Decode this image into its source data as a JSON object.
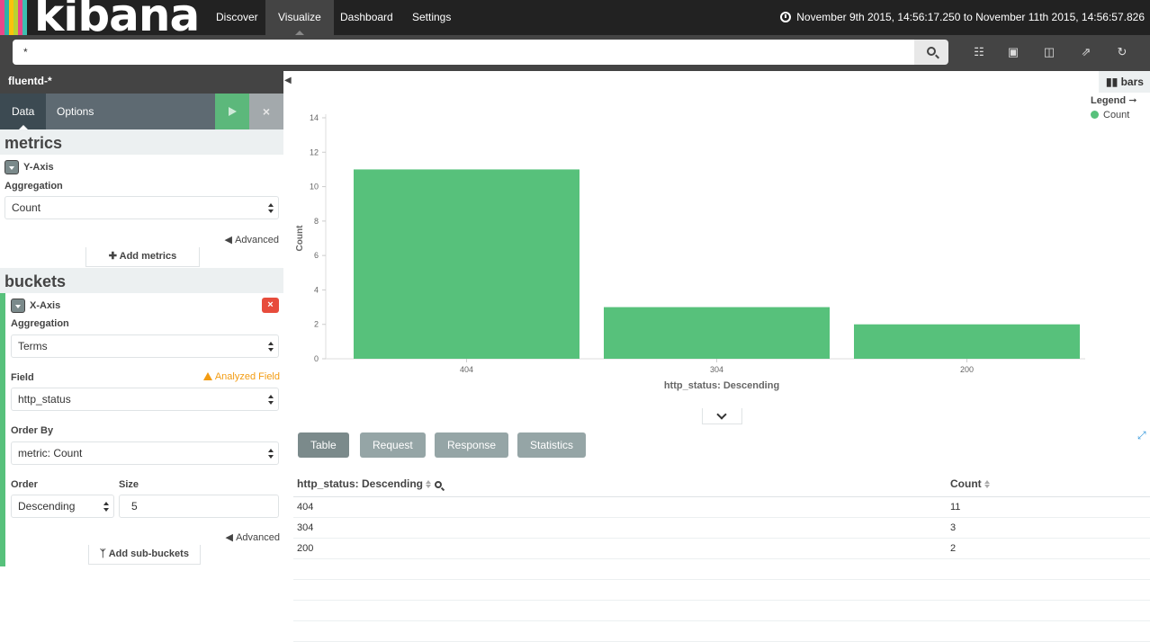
{
  "app": {
    "logo_text": "kibana"
  },
  "nav": {
    "tabs": [
      {
        "label": "Discover"
      },
      {
        "label": "Visualize"
      },
      {
        "label": "Dashboard"
      },
      {
        "label": "Settings"
      }
    ],
    "active": "Visualize",
    "time_range": "November 9th 2015, 14:56:17.250 to November 11th 2015, 14:56:57.826"
  },
  "search": {
    "value": "*"
  },
  "sidebar": {
    "index_pattern": "fluentd-*",
    "tabs": {
      "data": "Data",
      "options": "Options"
    },
    "metrics": {
      "title": "metrics",
      "yaxis_label": "Y-Axis",
      "aggregation_label": "Aggregation",
      "aggregation_value": "Count",
      "advanced": "Advanced",
      "add_button": "Add metrics"
    },
    "buckets": {
      "title": "buckets",
      "xaxis_label": "X-Axis",
      "aggregation_label": "Aggregation",
      "aggregation_value": "Terms",
      "field_label": "Field",
      "analyzed_warning": "Analyzed Field",
      "field_value": "http_status",
      "orderby_label": "Order By",
      "orderby_value": "metric: Count",
      "order_label": "Order",
      "order_value": "Descending",
      "size_label": "Size",
      "size_value": "5",
      "advanced": "Advanced",
      "add_button": "Add sub-buckets"
    }
  },
  "viz": {
    "chart_type_label": "bars",
    "legend_title": "Legend",
    "legend_item": "Count",
    "tabs": [
      "Table",
      "Request",
      "Response",
      "Statistics"
    ],
    "table": {
      "headers": [
        "http_status: Descending",
        "Count"
      ],
      "rows": [
        [
          "404",
          "11"
        ],
        [
          "304",
          "3"
        ],
        [
          "200",
          "2"
        ]
      ]
    }
  },
  "chart_data": {
    "type": "bar",
    "categories": [
      "404",
      "304",
      "200"
    ],
    "values": [
      11,
      3,
      2
    ],
    "xlabel": "http_status: Descending",
    "ylabel": "Count",
    "ylim": [
      0,
      14
    ],
    "yticks": [
      0,
      2,
      4,
      6,
      8,
      10,
      12,
      14
    ],
    "grid": false,
    "legend": "top-right",
    "bar_color": "#57c17b"
  }
}
